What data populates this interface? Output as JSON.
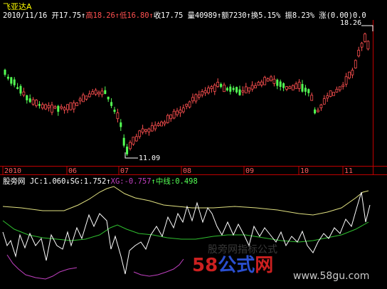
{
  "header": {
    "title": "飞亚达A",
    "date": "2010/11/16",
    "open_label": "开",
    "open": "17.75",
    "high_label": "高",
    "high": "18.26",
    "low_label": "低",
    "low": "16.80",
    "close_label": "收",
    "close": "17.75",
    "volume_label": "量",
    "volume": "40989",
    "amount_label": "额",
    "amount": "7230",
    "turnover_label": "换",
    "turnover": "5.15%",
    "amplitude_label": "振",
    "amplitude": "8.23%",
    "change_label": "涨",
    "change": "(0.00)",
    "trailing": "0.0"
  },
  "indicator": {
    "name": "股旁网",
    "jc_label": "JC:",
    "jc": "1.060",
    "sg_label": "SG:",
    "sg": "1.752",
    "xg_label": "XG:",
    "xg": "-0.757",
    "mid_label": "中线:",
    "mid": "0.498"
  },
  "axis": {
    "months": [
      "2010",
      "06",
      "07",
      "08",
      "09",
      "10",
      "11"
    ]
  },
  "annotations": {
    "high_marker": "18.26",
    "low_marker": "11.09"
  },
  "watermark": {
    "brand_number": "58",
    "brand_text": "公式",
    "brand_suffix": "网",
    "url": "www.58gu.com",
    "faint": "股旁网指标公式"
  },
  "colors": {
    "up": "#ff5050",
    "down": "#54ff54",
    "axis": "#c00000",
    "yellow_line": "#e0e080",
    "green_line": "#30c030",
    "magenta_line": "#c040c0"
  },
  "chart_data": {
    "type": "candlestick",
    "title": "飞亚达A",
    "x_labels": [
      "2010",
      "06",
      "07",
      "08",
      "09",
      "10",
      "11"
    ],
    "low": 11.09,
    "high": 18.26,
    "last_close": 17.75
  }
}
